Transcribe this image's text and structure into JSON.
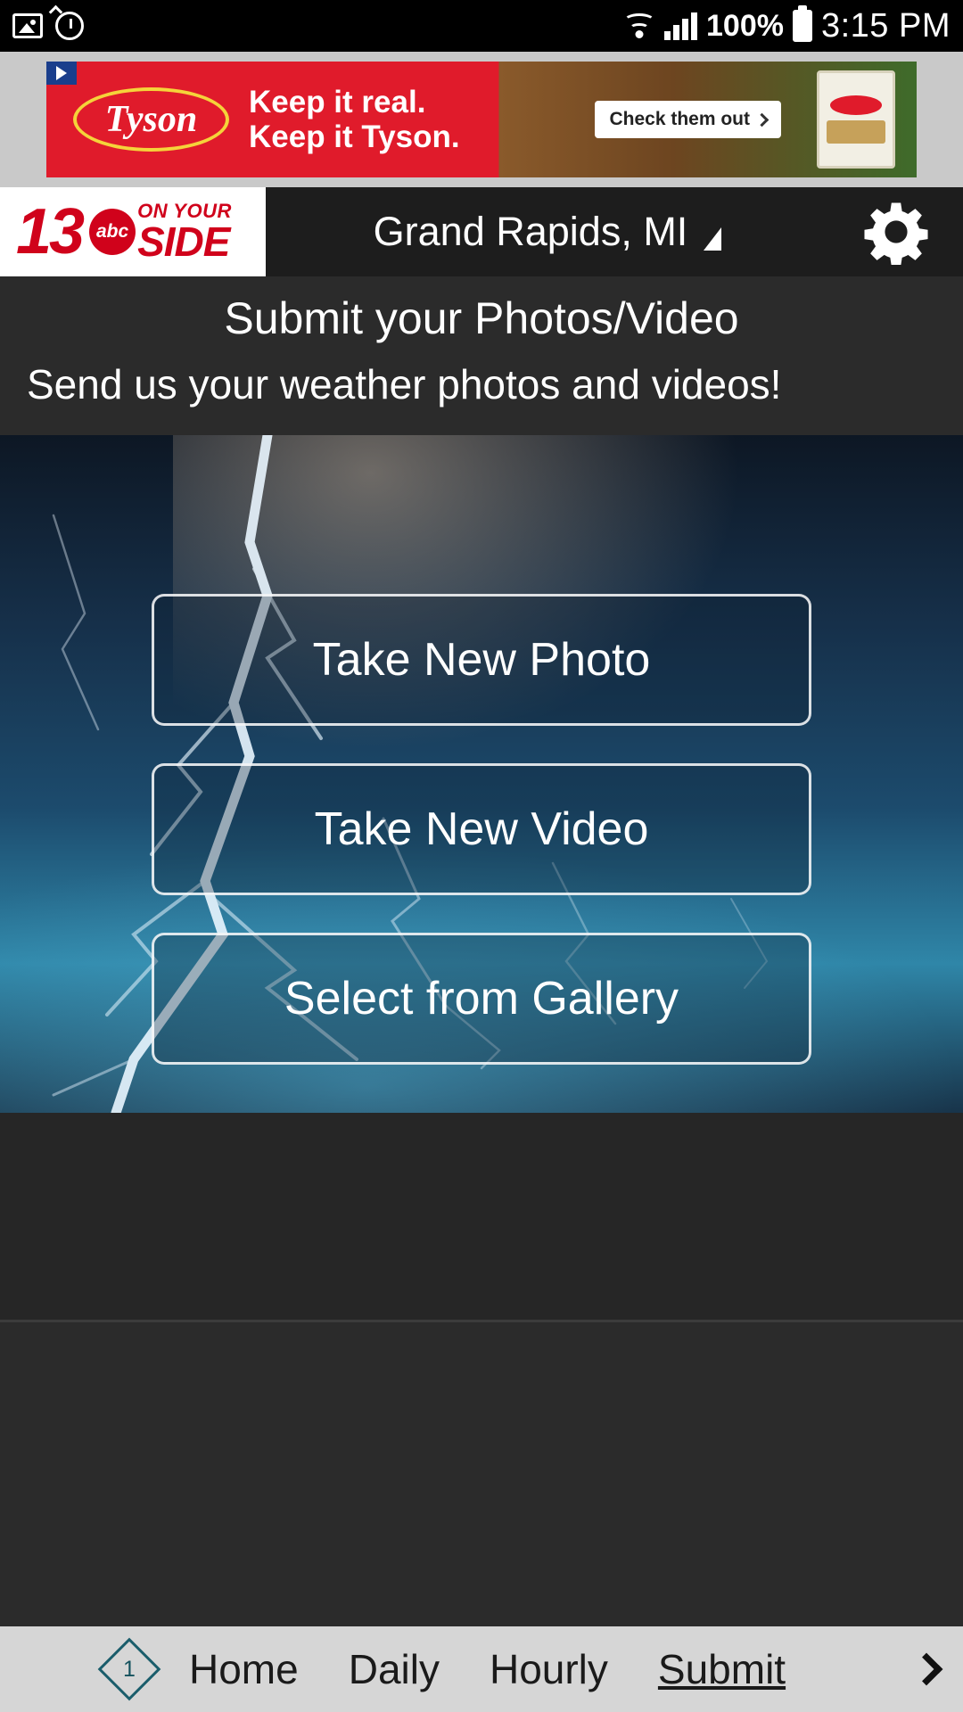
{
  "status_bar": {
    "time": "3:15 PM",
    "battery_percent": "100%",
    "icons": [
      "image-icon",
      "alarm-clock-icon",
      "wifi-icon",
      "cellular-signal-icon",
      "battery-icon"
    ]
  },
  "ad": {
    "brand": "Tyson",
    "line1": "Keep it real.",
    "line2": "Keep it Tyson.",
    "cta": "Check them out",
    "adchoices": "ad-choices-icon"
  },
  "app_header": {
    "logo_number": "13",
    "logo_on_your": "ON YOUR",
    "logo_side": "SIDE",
    "logo_network": "abc",
    "location": "Grand Rapids, MI",
    "settings_icon": "gear-icon"
  },
  "main": {
    "title": "Submit your Photos/Video",
    "subtitle": "Send us your weather photos and videos!",
    "buttons": [
      {
        "label": "Take New Photo",
        "name": "take-new-photo-button"
      },
      {
        "label": "Take New Video",
        "name": "take-new-video-button"
      },
      {
        "label": "Select from Gallery",
        "name": "select-from-gallery-button"
      }
    ]
  },
  "bottom_nav": {
    "badge_count": "1",
    "items": [
      {
        "label": "Home",
        "active": false
      },
      {
        "label": "Daily",
        "active": false
      },
      {
        "label": "Hourly",
        "active": false
      },
      {
        "label": "Submit",
        "active": true
      }
    ],
    "more_icon": "chevron-right-icon"
  },
  "colors": {
    "brand_red": "#d0021b",
    "ad_red": "#e01b2b",
    "header_dark": "#1d1d1d",
    "page_dark": "#2b2b2b",
    "nav_bg": "#d6d6d6"
  }
}
